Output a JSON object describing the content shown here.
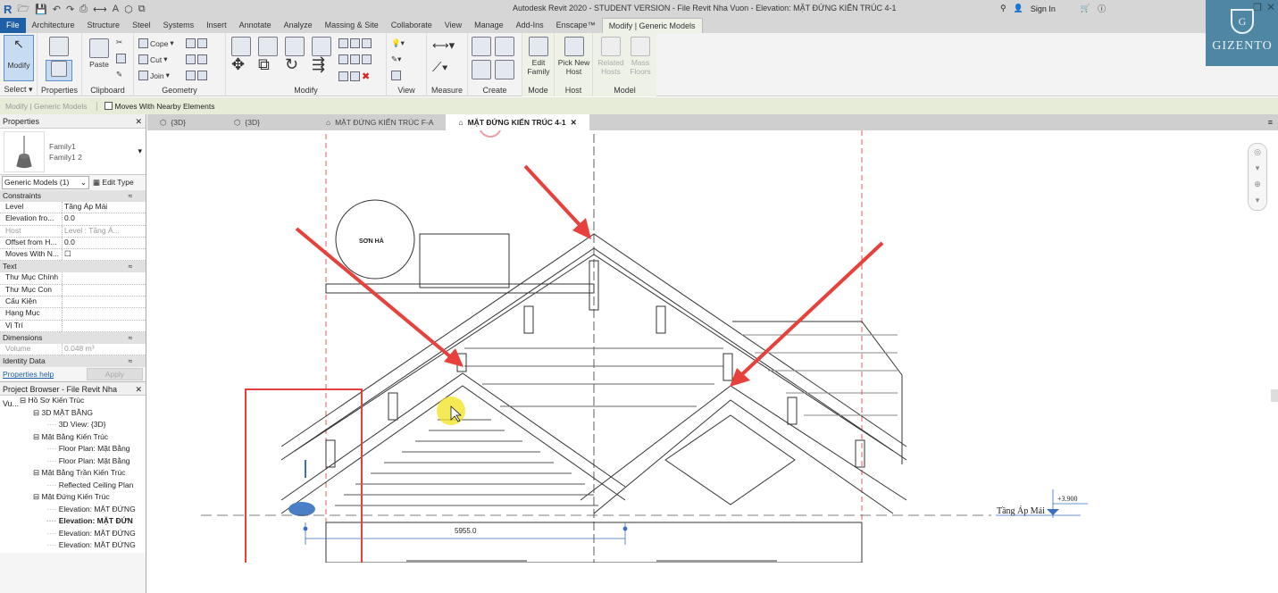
{
  "app": {
    "title": "Autodesk Revit 2020 - STUDENT VERSION - File Revit Nha Vuon - Elevation: MẶT ĐỨNG KIẾN TRÚC 4-1",
    "sign_in": "Sign In",
    "logo": "R"
  },
  "watermark": {
    "text": "GIZENTO",
    "letter": "G"
  },
  "tabs": [
    "File",
    "Architecture",
    "Structure",
    "Steel",
    "Systems",
    "Insert",
    "Annotate",
    "Analyze",
    "Massing & Site",
    "Collaborate",
    "View",
    "Manage",
    "Add-Ins",
    "Enscape™",
    "Modify | Generic Models"
  ],
  "ribbon": {
    "select": {
      "button": "Modify",
      "panel": "Select ▾"
    },
    "properties": {
      "panel": "Properties"
    },
    "clipboard": {
      "button": "Paste",
      "panel": "Clipboard"
    },
    "geometry": {
      "cope": "Cope",
      "cut": "Cut",
      "join": "Join",
      "panel": "Geometry"
    },
    "modify": {
      "panel": "Modify"
    },
    "view": {
      "panel": "View"
    },
    "measure": {
      "panel": "Measure"
    },
    "create": {
      "panel": "Create"
    },
    "mode": {
      "button": "Edit Family",
      "panel": "Mode"
    },
    "host": {
      "button": "Pick New Host",
      "panel": "Host"
    },
    "model": {
      "related": "Related Hosts",
      "mass": "Mass Floors",
      "panel": "Model"
    }
  },
  "options_bar": {
    "context": "Modify | Generic Models",
    "moves_with": "Moves With Nearby Elements",
    "moves_checked": false
  },
  "view_tabs": [
    {
      "label": "{3D}"
    },
    {
      "label": "{3D}"
    },
    {
      "label": "MẶT ĐỨNG KIẾN TRÚC F-A"
    },
    {
      "label": "MẶT ĐỨNG KIẾN TRÚC 4-1",
      "active": true
    }
  ],
  "properties": {
    "title": "Properties",
    "family": "Family1",
    "type": "Family1 2",
    "filter": "Generic Models (1)",
    "edit_type": "Edit Type",
    "groups": [
      {
        "name": "Constraints",
        "rows": [
          [
            "Level",
            "Tầng Áp Mái"
          ],
          [
            "Elevation fro...",
            "0.0"
          ],
          [
            "Host",
            "Level : Tầng Á..."
          ],
          [
            "Offset from H...",
            "0.0"
          ],
          [
            "Moves With N...",
            "☐"
          ]
        ]
      },
      {
        "name": "Text",
        "rows": [
          [
            "Thư Mục Chính",
            ""
          ],
          [
            "Thư Mục Con",
            ""
          ],
          [
            "Cấu Kiện",
            ""
          ],
          [
            "Hạng Mục",
            ""
          ],
          [
            "Vị Trí",
            ""
          ]
        ]
      },
      {
        "name": "Dimensions",
        "rows": [
          [
            "Volume",
            "0.048 m³"
          ]
        ]
      },
      {
        "name": "Identity Data",
        "rows": []
      }
    ],
    "help": "Properties help",
    "apply": "Apply"
  },
  "project_browser": {
    "title": "Project Browser - File Revit Nha Vu...",
    "items": [
      {
        "label": "Hồ Sơ Kiến Trúc",
        "level": 0
      },
      {
        "label": "3D MẶT BẰNG",
        "level": 1
      },
      {
        "label": "3D View: {3D}",
        "level": 2
      },
      {
        "label": "Mặt Bằng Kiến Trúc",
        "level": 1
      },
      {
        "label": "Floor Plan: Mặt Bằng",
        "level": 2
      },
      {
        "label": "Floor Plan: Mặt Bằng",
        "level": 2
      },
      {
        "label": "Mặt Bằng Trần Kiến Trúc",
        "level": 1
      },
      {
        "label": "Reflected Ceiling Plan",
        "level": 2
      },
      {
        "label": "Mặt Đứng Kiến Trúc",
        "level": 1
      },
      {
        "label": "Elevation: MẶT ĐỨNG",
        "level": 2
      },
      {
        "label": "Elevation: MẶT ĐỨN",
        "level": 2,
        "bold": true
      },
      {
        "label": "Elevation: MẶT ĐỨNG",
        "level": 2
      },
      {
        "label": "Elevation: MẶT ĐỨNG",
        "level": 2
      }
    ]
  },
  "drawing": {
    "tank_label": "SƠN HÀ",
    "dimension": "5955.0",
    "level_name": "Tầng Áp Mái",
    "level_elev": "+3.900",
    "annotation_color": "#e8403a"
  }
}
